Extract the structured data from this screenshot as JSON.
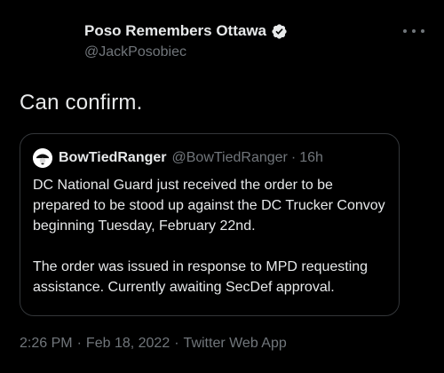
{
  "author": {
    "display_name": "Poso Remembers Ottawa",
    "handle": "@JackPosobiec",
    "verified": true
  },
  "tweet": {
    "text": "Can confirm."
  },
  "quoted_tweet": {
    "display_name": "BowTiedRanger",
    "handle": "@BowTiedRanger",
    "separator": "·",
    "time": "16h",
    "paragraphs": [
      "DC National Guard just received the order to be prepared to be stood up against the DC Trucker Convoy beginning Tuesday, February 22nd.",
      "The order was issued in response to MPD requesting assistance. Currently awaiting SecDef approval."
    ]
  },
  "meta": {
    "time": "2:26 PM",
    "separator": "·",
    "date": "Feb 18, 2022",
    "source": "Twitter Web App"
  },
  "icons": {
    "verified": "verified-badge-icon",
    "more": "more-options-icon"
  },
  "colors": {
    "background": "#000000",
    "text_primary": "#e7e9ea",
    "text_secondary": "#71767b",
    "border": "#333639"
  }
}
